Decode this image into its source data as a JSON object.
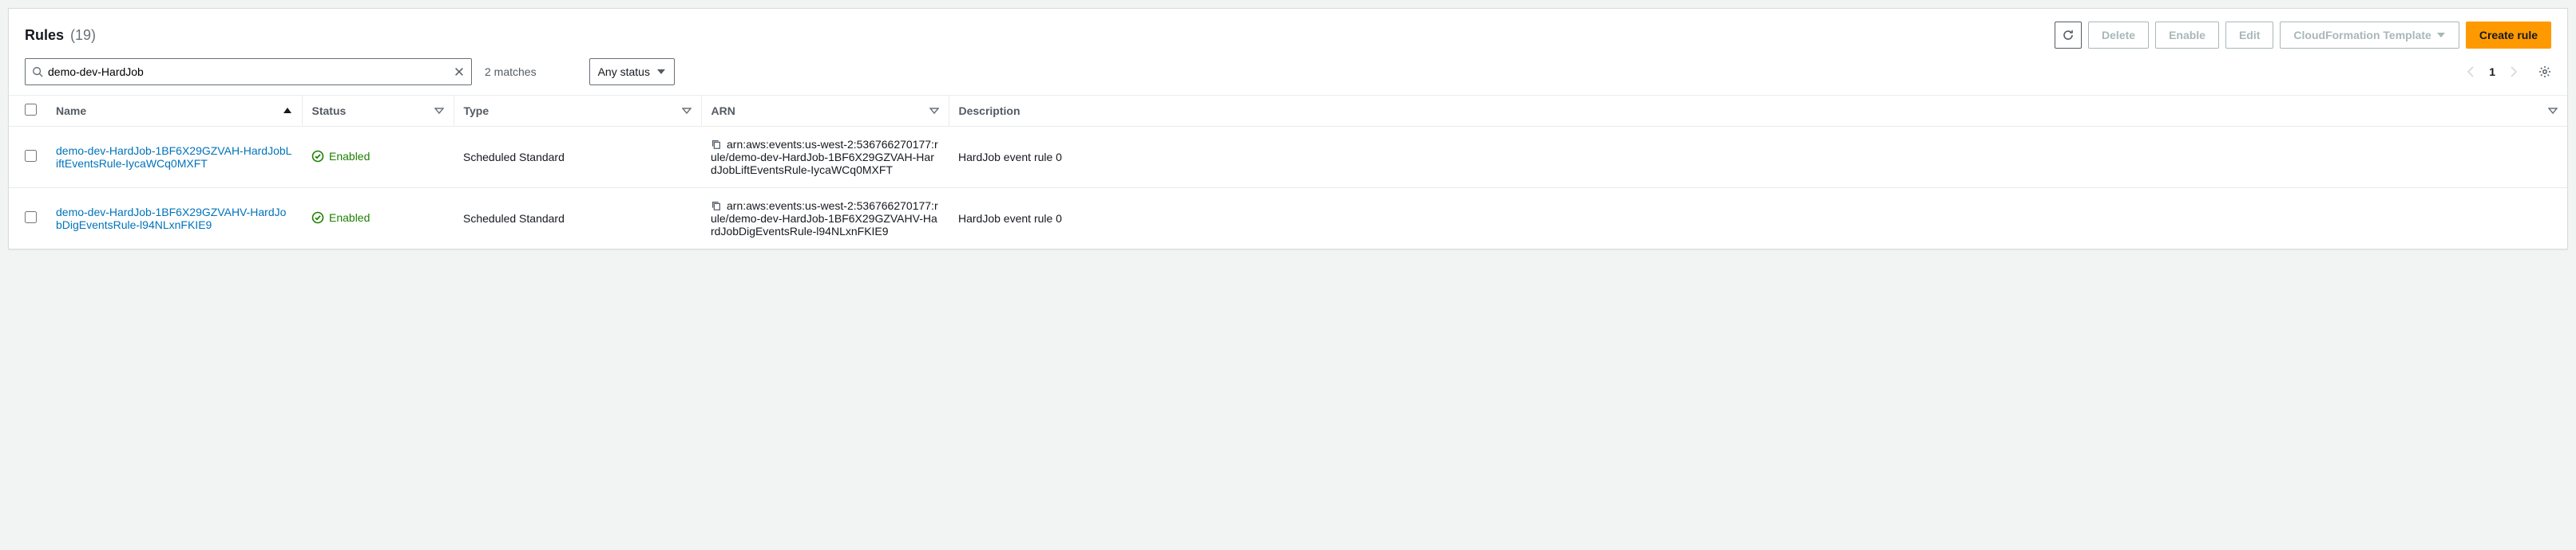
{
  "header": {
    "title": "Rules",
    "count": "(19)",
    "buttons": {
      "delete": "Delete",
      "enable": "Enable",
      "edit": "Edit",
      "cf_template": "CloudFormation Template",
      "create": "Create rule"
    }
  },
  "filter": {
    "search_value": "demo-dev-HardJob",
    "matches": "2 matches",
    "status_filter": "Any status",
    "page": "1"
  },
  "columns": {
    "name": "Name",
    "status": "Status",
    "type": "Type",
    "arn": "ARN",
    "description": "Description"
  },
  "rows": [
    {
      "name": "demo-dev-HardJob-1BF6X29GZVAH-HardJobLiftEventsRule-IycaWCq0MXFT",
      "status": "Enabled",
      "type": "Scheduled Standard",
      "arn": "arn:aws:events:us-west-2:536766270177:rule/demo-dev-HardJob-1BF6X29GZVAH-HardJobLiftEventsRule-IycaWCq0MXFT",
      "description": "HardJob event rule 0"
    },
    {
      "name": "demo-dev-HardJob-1BF6X29GZVAHV-HardJobDigEventsRule-l94NLxnFKIE9",
      "status": "Enabled",
      "type": "Scheduled Standard",
      "arn": "arn:aws:events:us-west-2:536766270177:rule/demo-dev-HardJob-1BF6X29GZVAHV-HardJobDigEventsRule-l94NLxnFKIE9",
      "description": "HardJob event rule 0"
    }
  ]
}
